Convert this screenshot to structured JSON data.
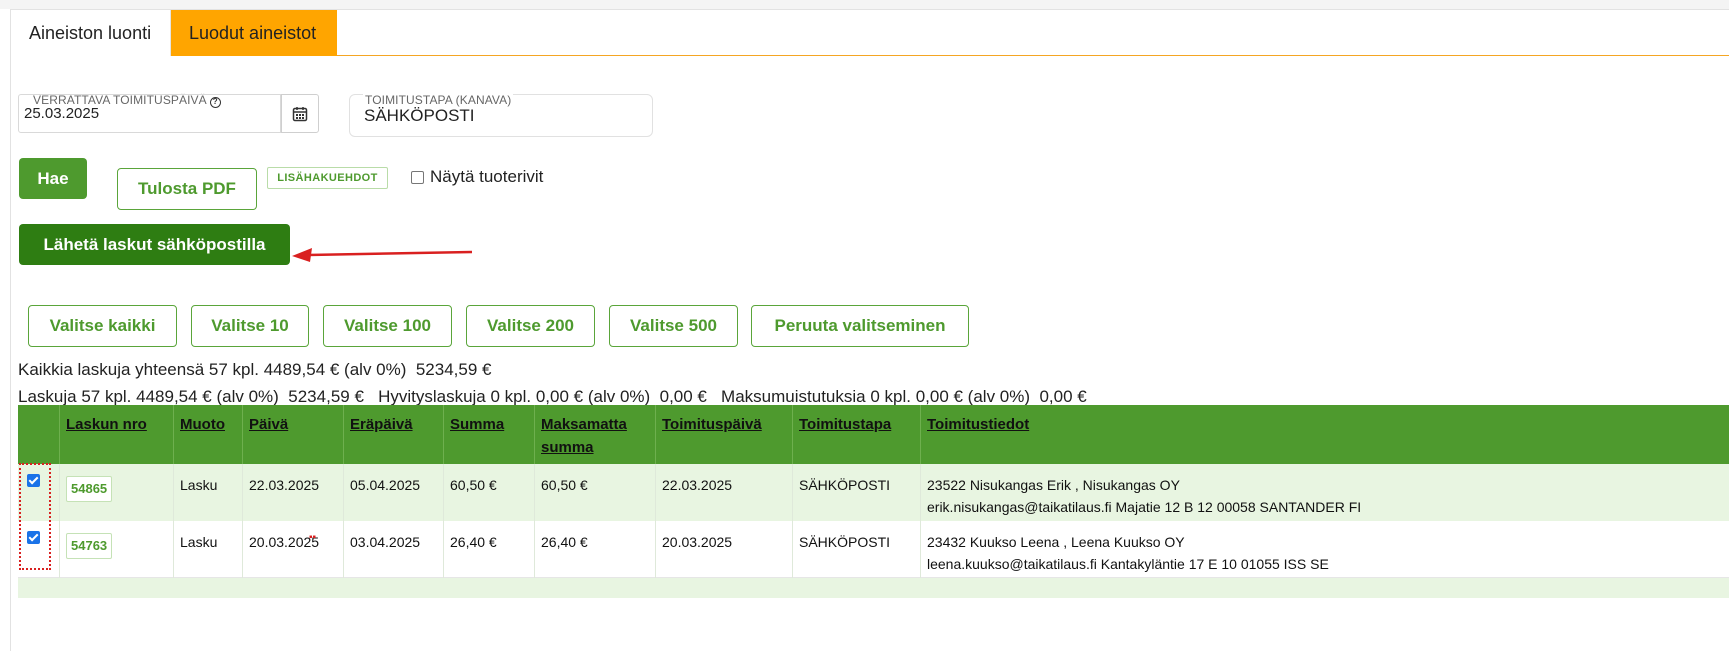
{
  "tabs": [
    {
      "label": "Aineiston luonti"
    },
    {
      "label": "Luodut aineistot"
    }
  ],
  "form": {
    "date_label": "VERRATTAVA TOIMITUSPÄIVÄ",
    "date_value": "25.03.2025",
    "channel_label": "TOIMITUSTAPA (KANAVA)",
    "channel_value": "SÄHKÖPOSTI"
  },
  "actions": {
    "search": "Hae",
    "print_pdf": "Tulosta PDF",
    "more_filters": "LISÄHAKUEHDOT",
    "show_product_rows": "Näytä tuoterivit",
    "send_email": "Lähetä laskut sähköpostilla"
  },
  "select_buttons": [
    {
      "label": "Valitse kaikki"
    },
    {
      "label": "Valitse 10"
    },
    {
      "label": "Valitse 100"
    },
    {
      "label": "Valitse 200"
    },
    {
      "label": "Valitse 500"
    },
    {
      "label": "Peruuta valitseminen"
    }
  ],
  "summary": {
    "line1": "Kaikkia laskuja yhteensä 57 kpl. 4489,54 € (alv 0%)  5234,59 €",
    "line2": "Laskuja 57 kpl. 4489,54 € (alv 0%)  5234,59 €   Hyvityslaskuja 0 kpl. 0,00 € (alv 0%)  0,00 €   Maksumuistutuksia 0 kpl. 0,00 € (alv 0%)  0,00 €"
  },
  "table": {
    "headers": [
      "Laskun nro",
      "Muoto",
      "Päivä",
      "Eräpäivä",
      "Summa",
      "Maksamatta summa",
      "Toimituspäivä",
      "Toimitustapa",
      "Toimitustiedot"
    ],
    "rows": [
      {
        "checked": true,
        "number": "54865",
        "form": "Lasku",
        "date": "22.03.2025",
        "due": "05.04.2025",
        "sum": "60,50 €",
        "unpaid": "60,50 €",
        "delivery_date": "22.03.2025",
        "channel": "SÄHKÖPOSTI",
        "info1": "23522 Nisukangas Erik , Nisukangas OY",
        "info2": "erik.nisukangas@taikatilaus.fi Majatie 12 B 12 00058 SANTANDER FI"
      },
      {
        "checked": true,
        "number": "54763",
        "form": "Lasku",
        "date": "20.03.2025",
        "due": "03.04.2025",
        "sum": "26,40 €",
        "unpaid": "26,40 €",
        "delivery_date": "20.03.2025",
        "channel": "SÄHKÖPOSTI",
        "info1": "23432 Kuukso Leena , Leena Kuukso OY",
        "info2": "leena.kuukso@taikatilaus.fi Kantakyläntie 17 E 10 01055 ISS SE"
      }
    ]
  },
  "colors": {
    "accent_green": "#4e9a2e",
    "dark_green": "#2e7d12",
    "orange_tab": "#ffa500",
    "annotation_red": "#d92020"
  }
}
